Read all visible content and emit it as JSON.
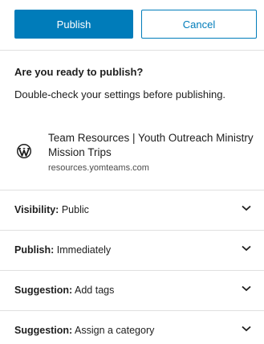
{
  "actions": {
    "publish_label": "Publish",
    "cancel_label": "Cancel"
  },
  "prepublish": {
    "heading": "Are you ready to publish?",
    "description": "Double-check your settings before publishing."
  },
  "site": {
    "title": "Team Resources | Youth Outreach Ministry Mission Trips",
    "url": "resources.yomteams.com",
    "icon": "wordpress-icon"
  },
  "panels": [
    {
      "key": "Visibility:",
      "value": "Public"
    },
    {
      "key": "Publish:",
      "value": "Immediately"
    },
    {
      "key": "Suggestion:",
      "value": "Add tags"
    },
    {
      "key": "Suggestion:",
      "value": "Assign a category"
    }
  ],
  "colors": {
    "accent": "#007cba",
    "divider": "#e0e0e0",
    "text": "#1e1e1e"
  }
}
